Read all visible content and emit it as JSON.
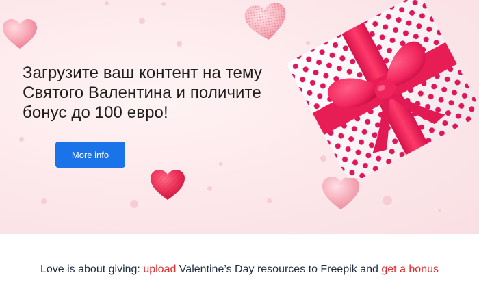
{
  "hero": {
    "headline": "Загрузите ваш контент на тему Святого Валентина и поличите бонус до 100 евро!",
    "button_label": "More info"
  },
  "tagline": {
    "part1": "Love is about giving: ",
    "link1": "upload",
    "part2": " Valentine’s Day resources to Freepik and ",
    "link2": "get a bonus"
  },
  "colors": {
    "button": "#1a73e8",
    "link": "#e32b2b",
    "ribbon": "#f0245c",
    "polka": "#e0155c"
  }
}
